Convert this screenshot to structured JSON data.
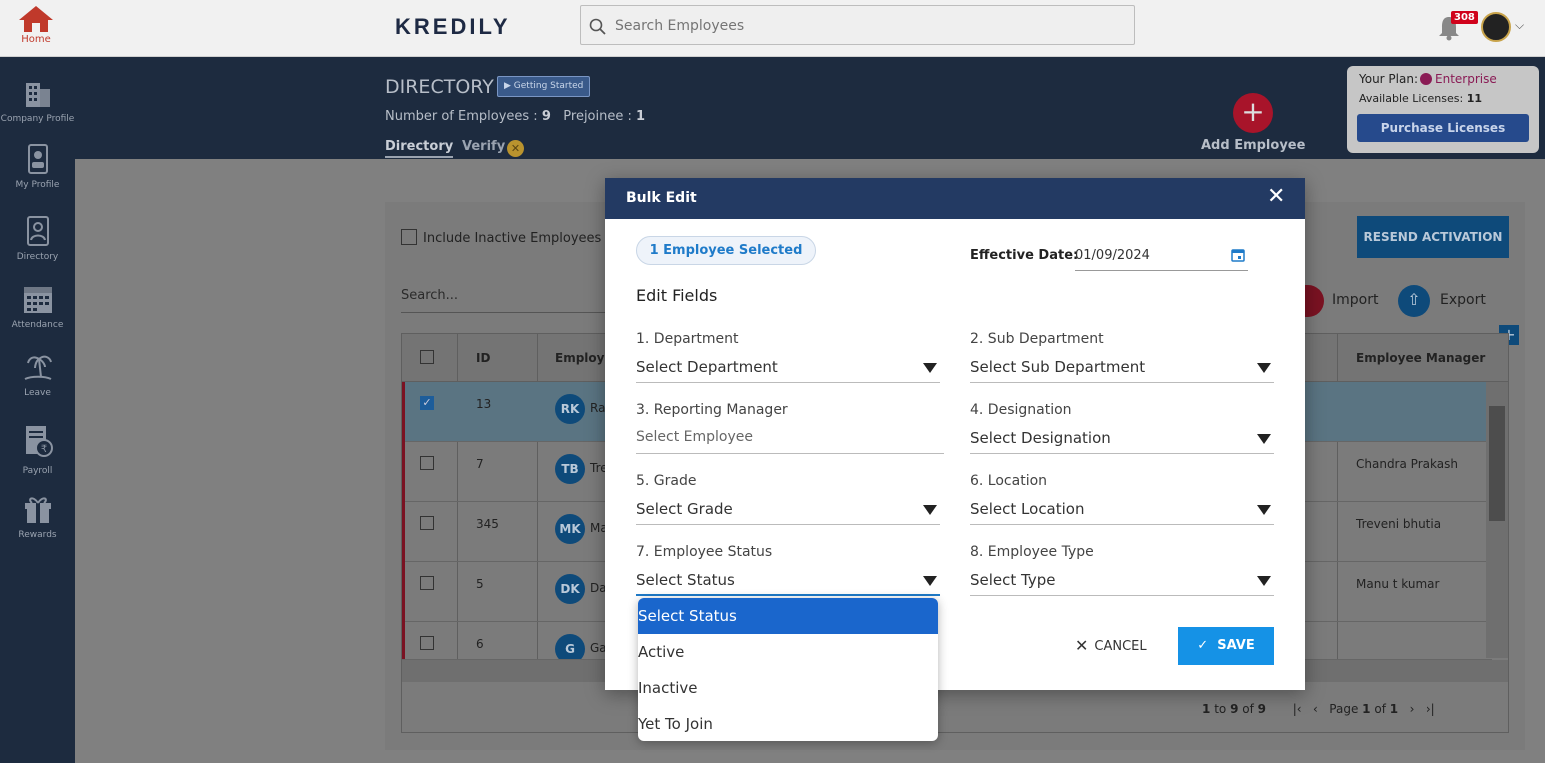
{
  "topbar": {
    "home_label": "Home",
    "logo": "KREDILY",
    "search_placeholder": "Search Employees",
    "notification_count": "308"
  },
  "sidebar": {
    "items": [
      {
        "label": "Company Profile",
        "icon": "building-icon"
      },
      {
        "label": "My Profile",
        "icon": "id-card-icon"
      },
      {
        "label": "Directory",
        "icon": "directory-icon"
      },
      {
        "label": "Attendance",
        "icon": "calendar-icon"
      },
      {
        "label": "Leave",
        "icon": "palm-tree-icon"
      },
      {
        "label": "Payroll",
        "icon": "rupee-document-icon"
      },
      {
        "label": "Rewards",
        "icon": "gift-icon"
      }
    ]
  },
  "header": {
    "title": "DIRECTORY",
    "getting_started": "Getting Started",
    "num_employees_label": "Number of Employees :",
    "num_employees": "9",
    "prejoinee_label": "Prejoinee :",
    "prejoinee": "1",
    "tabs": [
      "Directory",
      "Verify"
    ],
    "add_employee": "Add Employee"
  },
  "plan": {
    "label": "Your Plan:",
    "name": "Enterprise",
    "licenses_label": "Available Licenses:",
    "licenses": "11",
    "purchase": "Purchase Licenses"
  },
  "directory": {
    "include_inactive": "Include Inactive Employees",
    "search_placeholder": "Search...",
    "resend": "RESEND ACTIVATION",
    "import": "Import",
    "export": "Export",
    "columns": [
      "ID",
      "Employe",
      "Employee Manager"
    ],
    "rows": [
      {
        "id": "13",
        "initials": "RK",
        "name": "Ra",
        "manager": "",
        "checked": true
      },
      {
        "id": "7",
        "initials": "TB",
        "name": "Tre",
        "manager": "Chandra Prakash",
        "checked": false
      },
      {
        "id": "345",
        "initials": "MK",
        "name": "Ma",
        "manager": "Treveni bhutia",
        "checked": false
      },
      {
        "id": "5",
        "initials": "DK",
        "name": "Da",
        "manager": "Manu t kumar",
        "checked": false
      },
      {
        "id": "6",
        "initials": "G",
        "name": "Ga",
        "manager": "",
        "checked": false
      }
    ],
    "pager_range_start": "1",
    "pager_to": "to",
    "pager_range_end": "9",
    "pager_of": "of",
    "pager_total": "9",
    "pager_page": "Page",
    "pager_current": "1",
    "pager_page_of": "of",
    "pager_pages": "1"
  },
  "modal": {
    "title": "Bulk Edit",
    "selected_chip": "1 Employee Selected",
    "effective_label": "Effective Date:",
    "effective_value": "01/09/2024",
    "edit_fields": "Edit Fields",
    "fields": [
      {
        "label": "1. Department",
        "value": "Select Department"
      },
      {
        "label": "2. Sub Department",
        "value": "Select Sub Department"
      },
      {
        "label": "3. Reporting Manager",
        "value": "Select Employee"
      },
      {
        "label": "4. Designation",
        "value": "Select Designation"
      },
      {
        "label": "5. Grade",
        "value": "Select Grade"
      },
      {
        "label": "6. Location",
        "value": "Select Location"
      },
      {
        "label": "7. Employee Status",
        "value": "Select Status"
      },
      {
        "label": "8. Employee Type",
        "value": "Select Type"
      }
    ],
    "cancel": "CANCEL",
    "save": "SAVE"
  },
  "status_dropdown": {
    "options": [
      "Select Status",
      "Active",
      "Inactive",
      "Yet To Join"
    ],
    "highlighted": "Select Status"
  }
}
